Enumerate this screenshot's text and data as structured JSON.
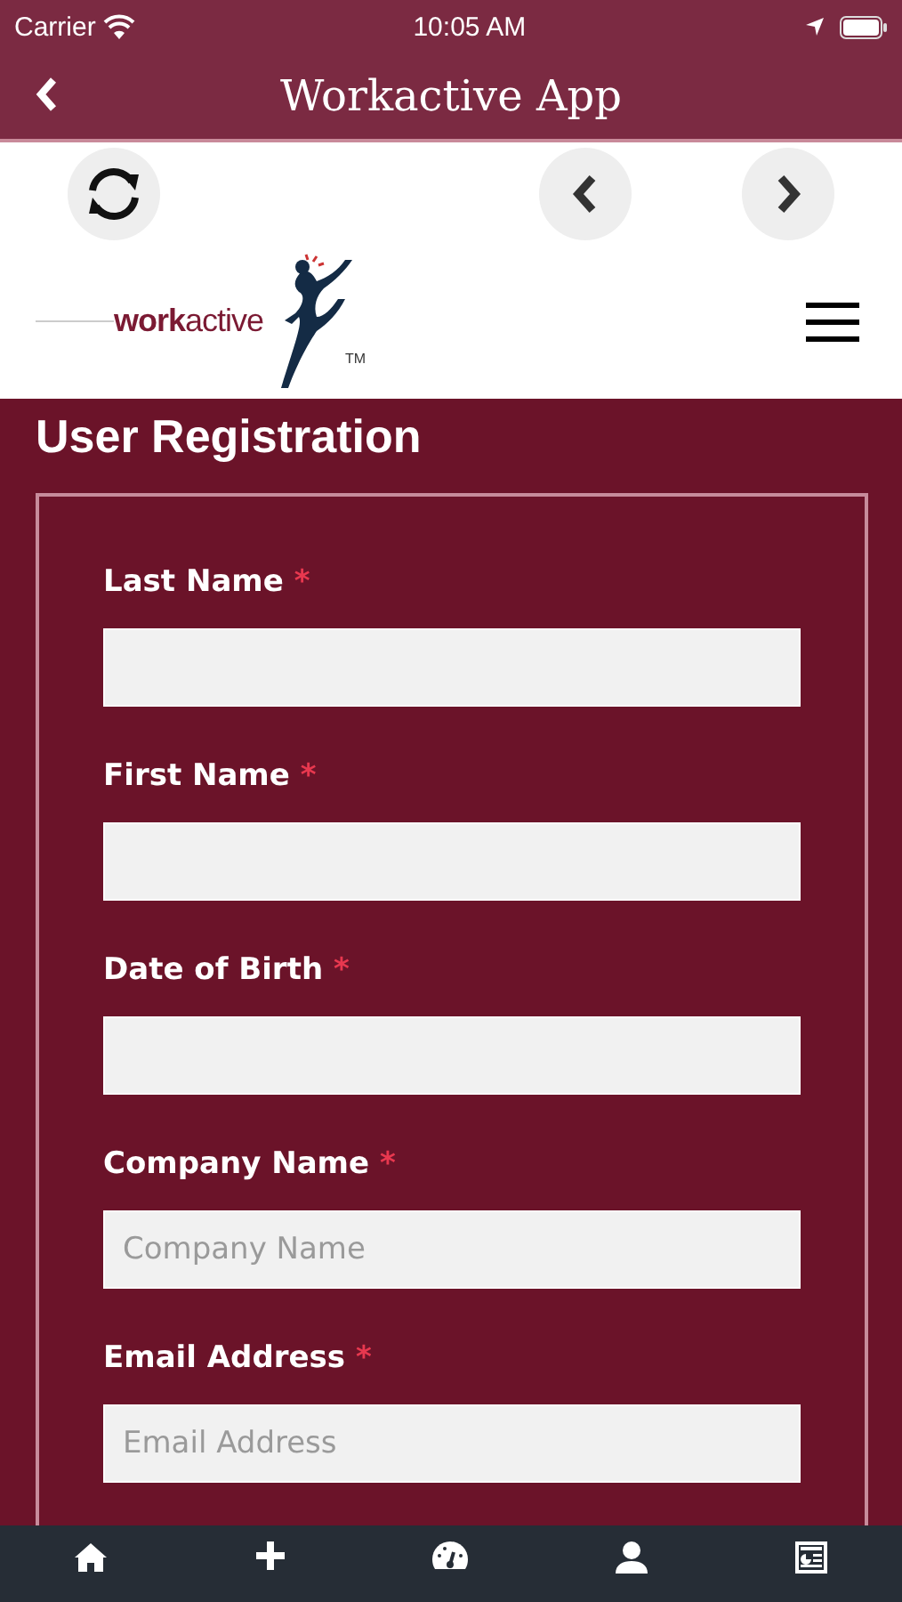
{
  "status_bar": {
    "carrier": "Carrier",
    "time": "10:05 AM"
  },
  "nav_bar": {
    "title": "Workactive App"
  },
  "logo": {
    "text": "**work**active",
    "trademark": "TM"
  },
  "heading": "User Registration",
  "form": {
    "fields": [
      {
        "label": "Last Name",
        "required_mark": "*"
      },
      {
        "label": "First Name",
        "required_mark": "*"
      },
      {
        "label": "Date of Birth",
        "required_mark": "*"
      },
      {
        "label": "Company Name",
        "required_mark": "*",
        "placeholder": "Company Name"
      },
      {
        "label": "Email Address",
        "required_mark": "*",
        "placeholder": "Email Address"
      }
    ]
  },
  "tab_bar": {
    "items": [
      {
        "kind": "home"
      },
      {
        "kind": "plus"
      },
      {
        "kind": "gauge"
      },
      {
        "kind": "person"
      },
      {
        "kind": "news"
      }
    ]
  }
}
